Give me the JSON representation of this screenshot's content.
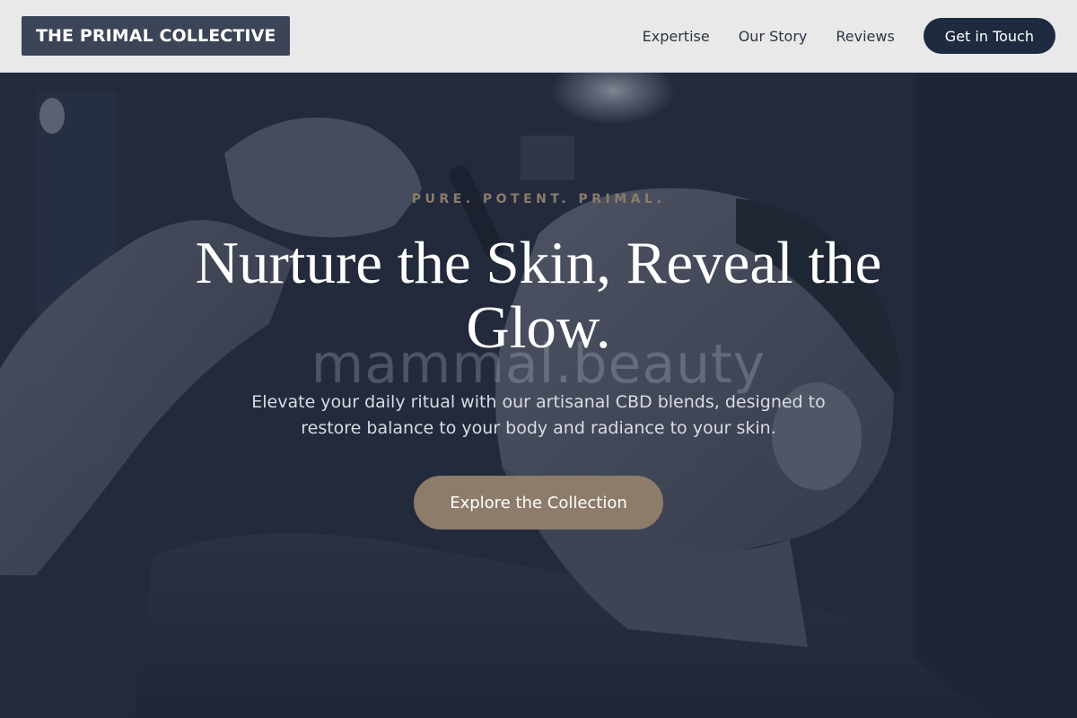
{
  "header": {
    "logo": "THE PRIMAL COLLECTIVE",
    "nav": [
      "Expertise",
      "Our Story",
      "Reviews"
    ],
    "cta": "Get in Touch"
  },
  "hero": {
    "eyebrow": "PURE. POTENT. PRIMAL.",
    "headline": "Nurture the Skin, Reveal the Glow.",
    "watermark": "mammal.beauty",
    "subtitle": "Elevate your daily ritual with our artisanal CBD blends, designed to restore balance to your body and radiance to your skin.",
    "button": "Explore the Collection"
  },
  "colors": {
    "header_bg": "#e9e9ea",
    "logo_bg": "#3c4557",
    "cta_bg": "#1d2a3f",
    "accent": "#8d7c6a",
    "eyebrow": "#8b7c6a"
  }
}
